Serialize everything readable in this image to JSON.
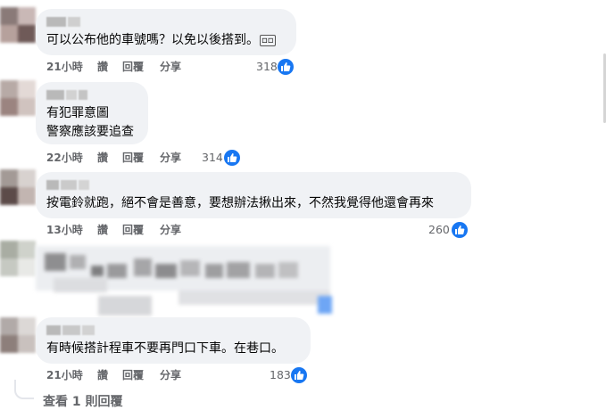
{
  "colors": {
    "bubble": "#f0f2f5",
    "meta_text": "#65676b",
    "like_blue": "#1877f2"
  },
  "comments": [
    {
      "text": "可以公布他的車號嗎？以免以後搭到。",
      "emoji_glyph": "🆖",
      "time": "21小時",
      "like_label": "讚",
      "reply_label": "回覆",
      "share_label": "分享",
      "reactions": "318",
      "reaction_icon": "like-icon"
    },
    {
      "text": "有犯罪意圖\n警察應該要追查",
      "time": "22小時",
      "like_label": "讚",
      "reply_label": "回覆",
      "share_label": "分享",
      "reactions": "314",
      "reaction_icon": "like-icon"
    },
    {
      "text": "按電鈴就跑，絕不會是善意，要想辦法揪出來，不然我覺得他還會再來",
      "time": "13小時",
      "like_label": "讚",
      "reply_label": "回覆",
      "share_label": "分享",
      "reactions": "260",
      "reaction_icon": "like-icon"
    },
    {
      "text": "",
      "censored": true
    },
    {
      "text": "有時候搭計程車不要再門口下車。在巷口。",
      "time": "21小時",
      "like_label": "讚",
      "reply_label": "回覆",
      "share_label": "分享",
      "reactions": "183",
      "reaction_icon": "like-icon"
    }
  ],
  "view_replies": "查看 1 則回覆"
}
